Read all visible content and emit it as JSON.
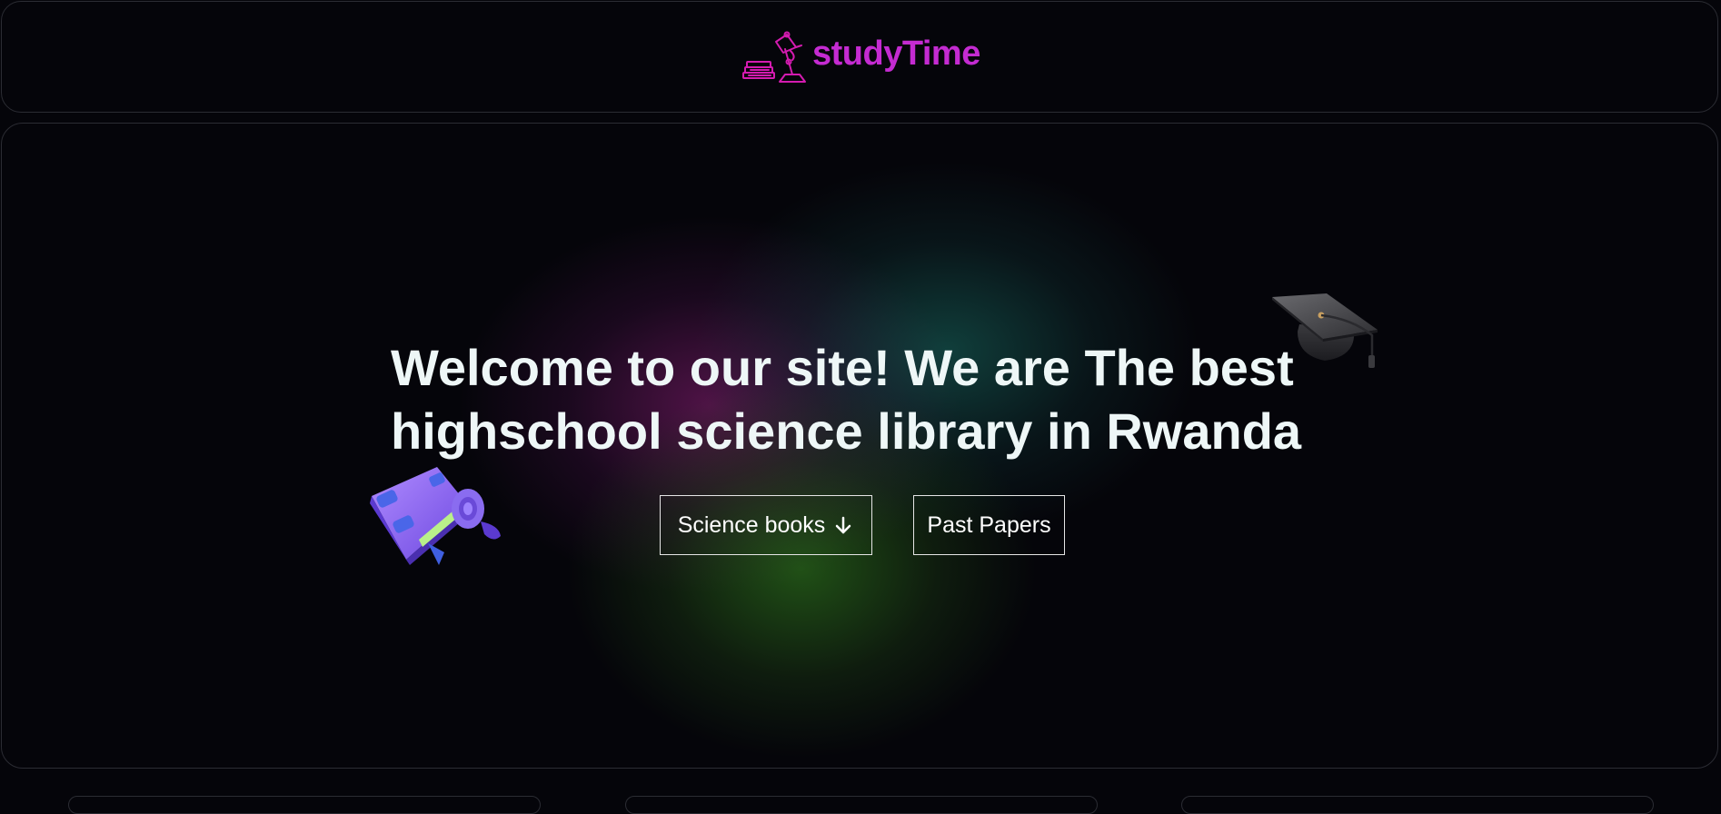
{
  "header": {
    "brand_name": "studyTime",
    "logo_icon": "desk-lamp-books-icon"
  },
  "hero": {
    "headline": "Welcome to our site! We are The best highschool science library in Rwanda",
    "buttons": {
      "science_books": "Science books",
      "past_papers": "Past Papers"
    },
    "decorations": [
      "graduation-cap-icon",
      "book-icon"
    ]
  },
  "colors": {
    "background": "#05050a",
    "brand": "#c42bd1",
    "text": "#eef7f7",
    "border": "#2b2c33"
  }
}
